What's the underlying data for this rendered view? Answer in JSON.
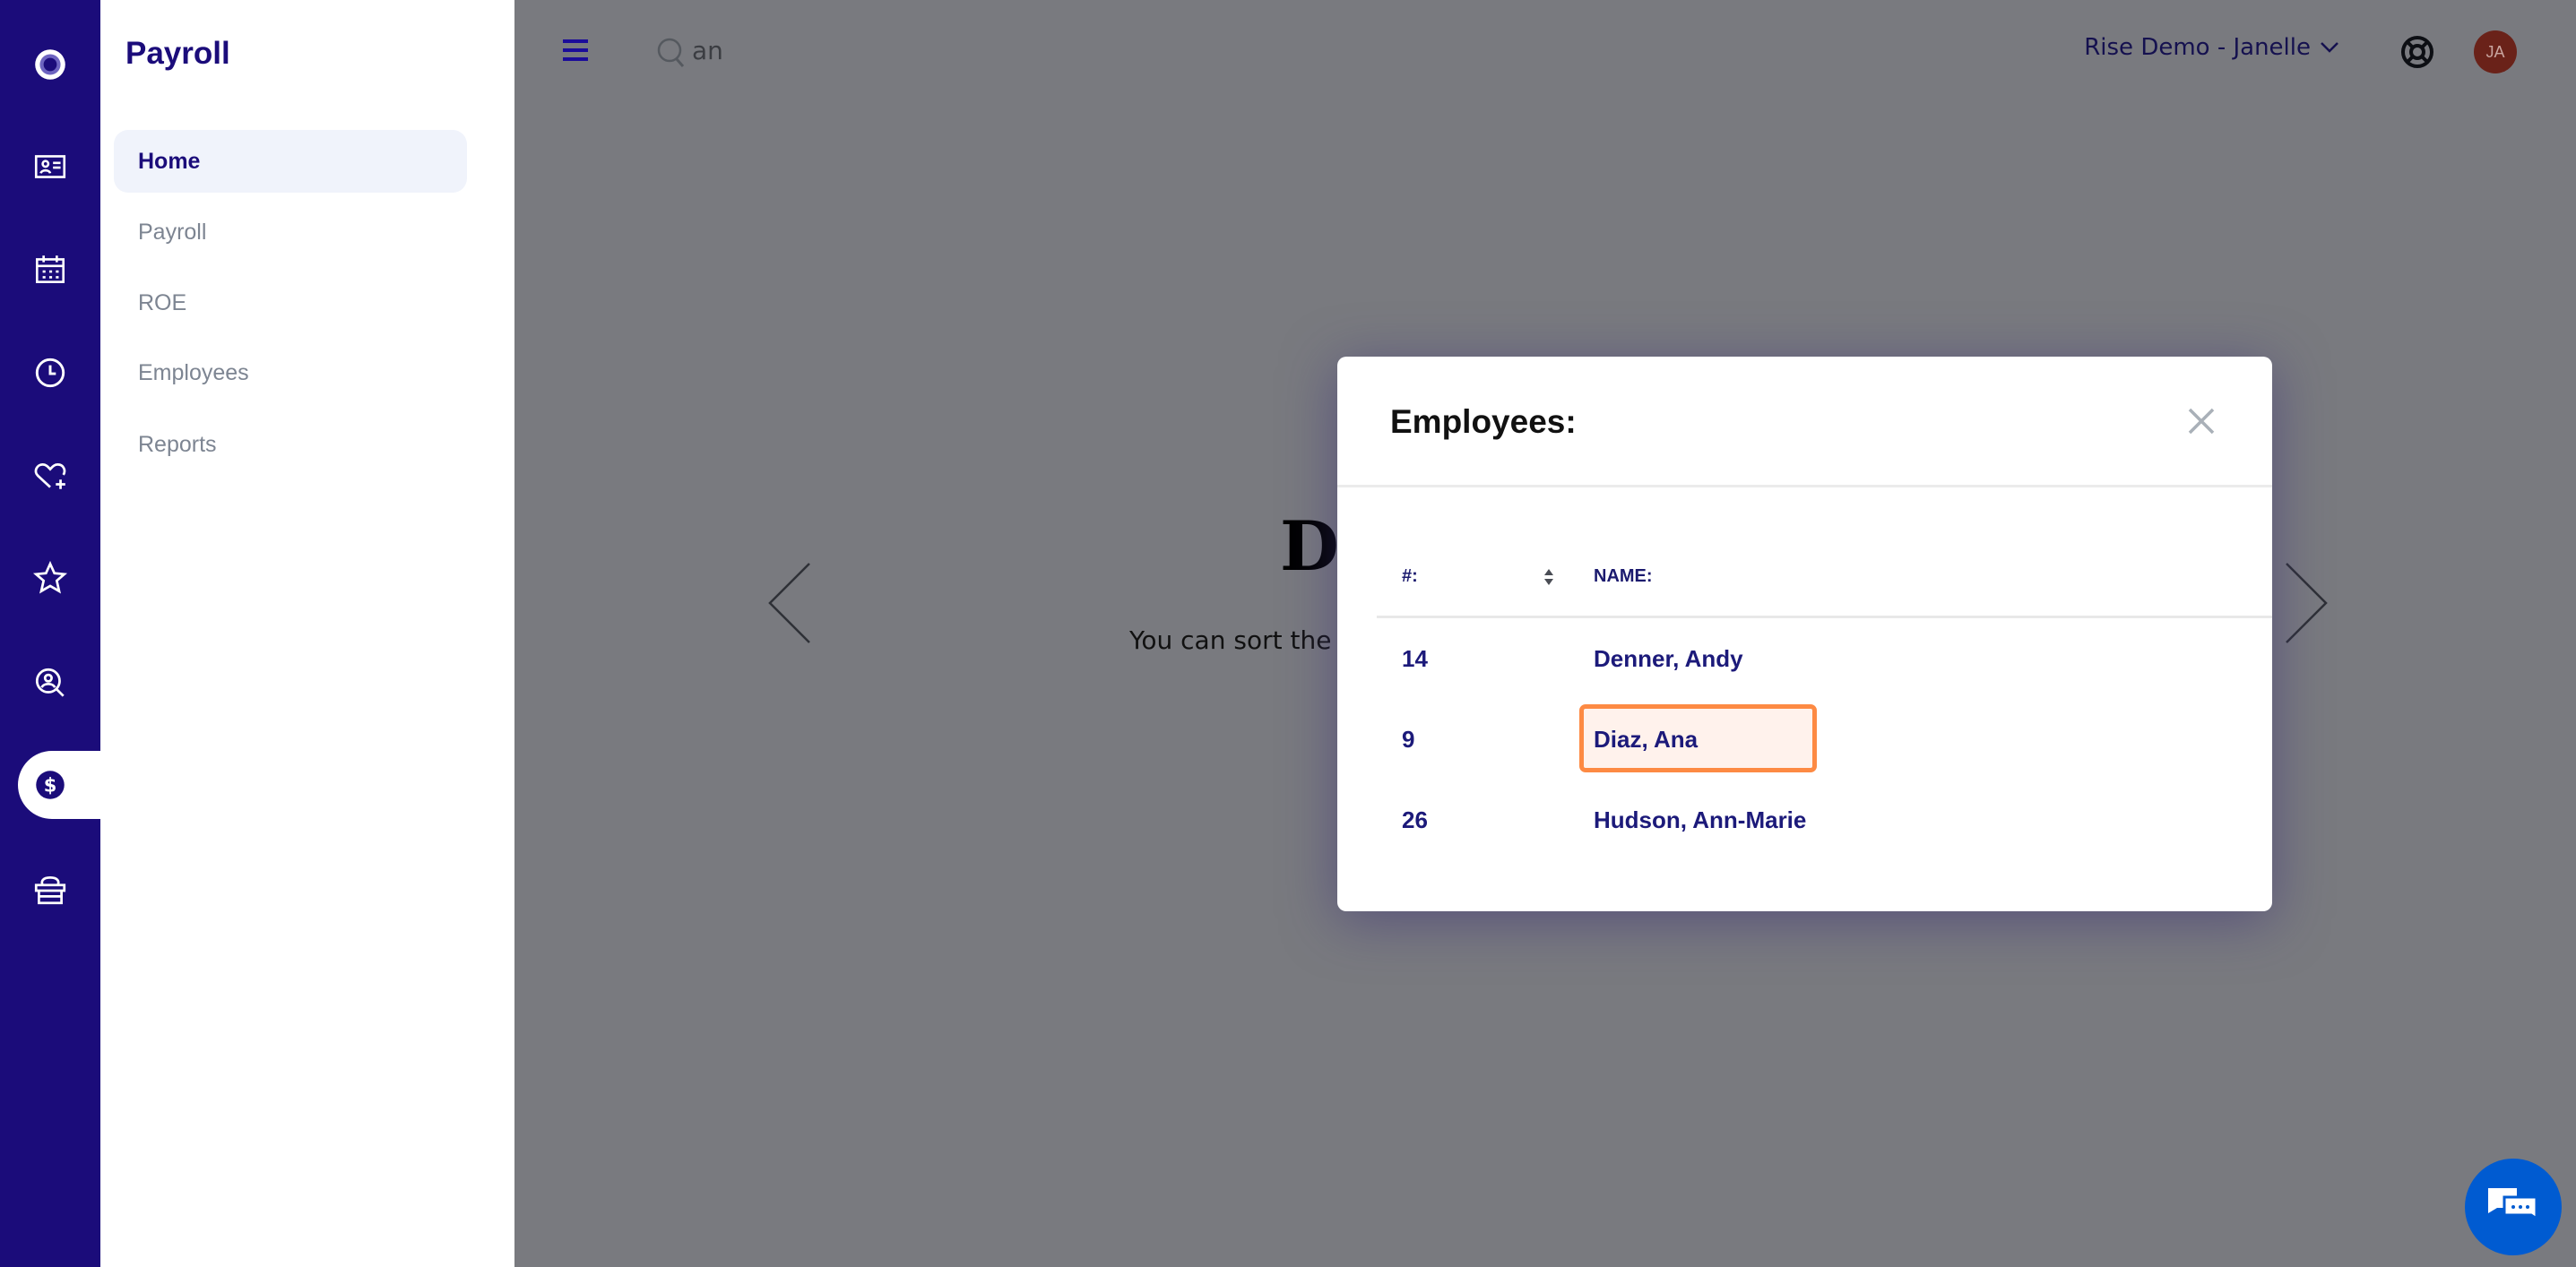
{
  "rail": {
    "icons": [
      "logo-icon",
      "id-card-icon",
      "calendar-icon",
      "clock-icon",
      "heart-plus-icon",
      "star-icon",
      "user-search-icon",
      "dollar-icon",
      "gift-box-icon"
    ],
    "active": "dollar-icon",
    "color": "#1b0c7a"
  },
  "sidebar": {
    "title": "Payroll",
    "items": [
      {
        "label": "Home",
        "active": true
      },
      {
        "label": "Payroll"
      },
      {
        "label": "ROE"
      },
      {
        "label": "Employees"
      },
      {
        "label": "Reports"
      }
    ]
  },
  "header": {
    "search_value": "an",
    "account_label": "Rise Demo - Janelle",
    "avatar_initials": "JA"
  },
  "background": {
    "heading": "Di",
    "text": "You can sort the c"
  },
  "modal": {
    "title": "Employees:",
    "columns": [
      "#:",
      "NAME:"
    ],
    "rows": [
      {
        "num": "14",
        "name": "Denner, Andy"
      },
      {
        "num": "9",
        "name": "Diaz, Ana",
        "highlighted": true
      },
      {
        "num": "26",
        "name": "Hudson, Ann-Marie"
      }
    ],
    "highlight_color": "#fd8a43"
  }
}
